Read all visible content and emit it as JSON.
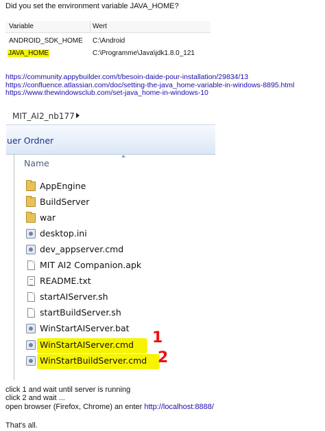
{
  "question": "Did you set the environment variable JAVA_HOME?",
  "env_table": {
    "col_variable": "Variable",
    "col_value": "Wert",
    "rows": [
      {
        "name": "ANDROID_SDK_HOME",
        "value": "C:\\Android"
      },
      {
        "name": "JAVA_HOME",
        "value": "C:\\Programme\\Java\\jdk1.8.0_121"
      }
    ],
    "highlight_color": "#f5f500"
  },
  "links": [
    "https://community.appybuilder.com/t/besoin-daide-pour-installation/29834/13",
    "https://confluence.atlassian.com/doc/setting-the-java_home-variable-in-windows-8895.html",
    "https://www.thewindowsclub.com/set-java_home-in-windows-10"
  ],
  "explorer": {
    "breadcrumb": "MIT_AI2_nb177",
    "toolbar_label": "uer Ordner",
    "column_header": "Name",
    "files": [
      {
        "name": "AppEngine",
        "icon": "folder-icon"
      },
      {
        "name": "BuildServer",
        "icon": "folder-icon"
      },
      {
        "name": "war",
        "icon": "folder-icon"
      },
      {
        "name": "desktop.ini",
        "icon": "settings-file-icon"
      },
      {
        "name": "dev_appserver.cmd",
        "icon": "cmd-file-icon"
      },
      {
        "name": "MIT AI2 Companion.apk",
        "icon": "file-icon"
      },
      {
        "name": "README.txt",
        "icon": "text-file-icon"
      },
      {
        "name": "startAIServer.sh",
        "icon": "file-icon"
      },
      {
        "name": "startBuildServer.sh",
        "icon": "file-icon"
      },
      {
        "name": "WinStartAIServer.bat",
        "icon": "batch-file-icon"
      },
      {
        "name": "WinStartAIServer.cmd",
        "icon": "cmd-file-icon"
      },
      {
        "name": "WinStartBuildServer.cmd",
        "icon": "cmd-file-icon"
      }
    ],
    "marks": [
      "1",
      "2"
    ],
    "mark_color": "#ee1111"
  },
  "instructions": {
    "line1": "click 1 and wait until server is running",
    "line2": "click 2 and wait ...",
    "line3_prefix": "open browser (Firefox, Chrome) an enter ",
    "line3_link": "http://localhost:8888/"
  },
  "closing": "That's all."
}
